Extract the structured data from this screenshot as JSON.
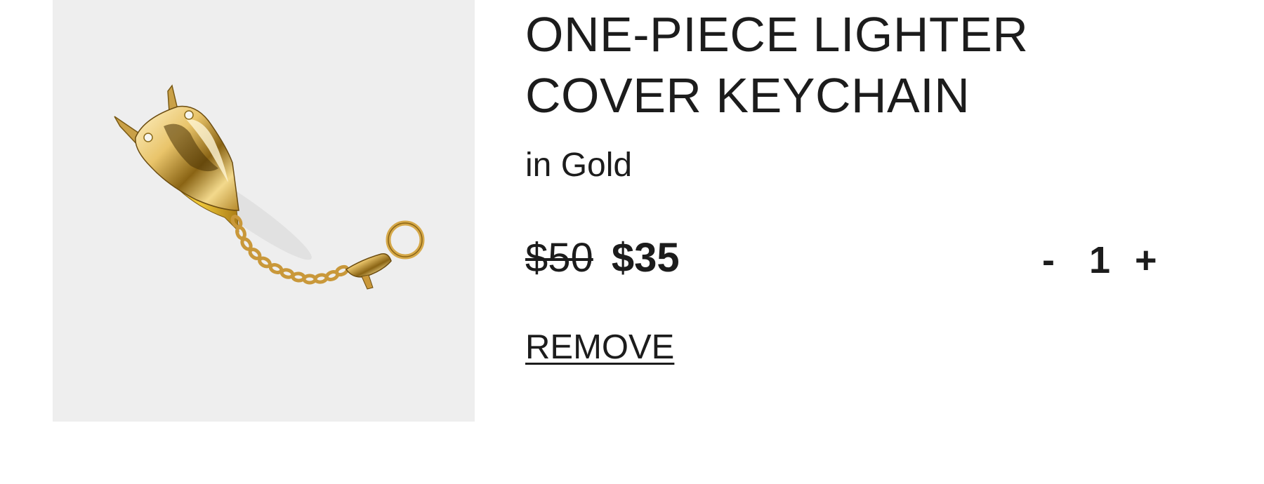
{
  "product": {
    "title": "ONE-PIECE LIGHTER COVER KEYCHAIN",
    "variant": "in Gold",
    "image_alt": "Gold lighter cover keychain with chain and lobster clasp",
    "price_original": "$50",
    "price_sale": "$35"
  },
  "quantity": {
    "decrement_label": "-",
    "value": "1",
    "increment_label": "+"
  },
  "actions": {
    "remove_label": "REMOVE"
  },
  "colors": {
    "image_background": "#eeeeee",
    "text": "#1c1c1c",
    "gold": "#d8b25a"
  }
}
